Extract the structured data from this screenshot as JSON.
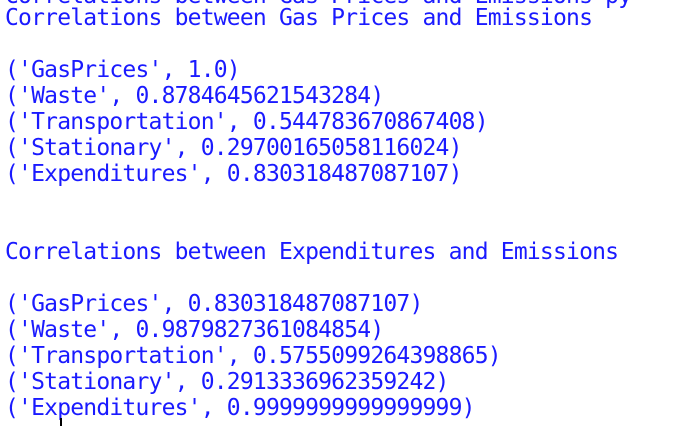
{
  "console": {
    "clipped_line": "Correlations between Gas Prices and Emissions py",
    "section1": {
      "heading": "Correlations between Gas Prices and Emissions",
      "rows": [
        "('GasPrices', 1.0)",
        "('Waste', 0.8784645621543284)",
        "('Transportation', 0.544783670867408)",
        "('Stationary', 0.29700165058116024)",
        "('Expenditures', 0.830318487087107)"
      ]
    },
    "section2": {
      "heading": "Correlations between Expenditures and Emissions",
      "rows": [
        "('GasPrices', 0.830318487087107)",
        "('Waste', 0.9879827361084854)",
        "('Transportation', 0.5755099264398865)",
        "('Stationary', 0.2913336962359242)",
        "('Expenditures', 0.9999999999999999)"
      ]
    },
    "colors": {
      "text": "#1a1aff",
      "background": "#ffffff"
    }
  }
}
